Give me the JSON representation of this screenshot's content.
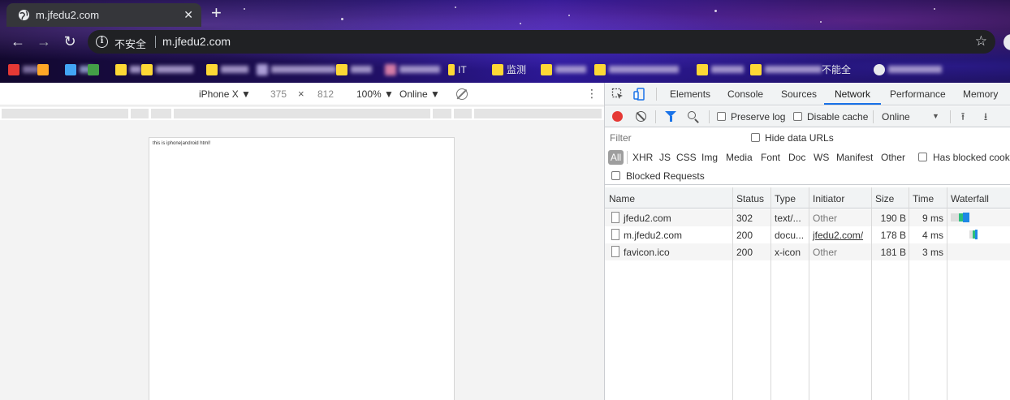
{
  "browser": {
    "tab_title": "m.jfedu2.com",
    "new_tab": "+",
    "tab_close": "✕",
    "security_label": "不安全",
    "url": "m.jfedu2.com",
    "bookmarks": [
      "IT",
      "监测",
      "不能全"
    ]
  },
  "device_toolbar": {
    "device": "iPhone X ▼",
    "width": "375",
    "times": "×",
    "height": "812",
    "zoom": "100% ▼",
    "network": "Online ▼",
    "more": "⋮"
  },
  "device_page": {
    "text": "this is iphone|android html!"
  },
  "devtools": {
    "tabs": [
      "Elements",
      "Console",
      "Sources",
      "Network",
      "Performance",
      "Memory"
    ],
    "active_tab": "Network",
    "preserve_log": "Preserve log",
    "disable_cache": "Disable cache",
    "throttling": "Online",
    "filter_placeholder": "Filter",
    "hide_data_urls": "Hide data URLs",
    "types": [
      "All",
      "XHR",
      "JS",
      "CSS",
      "Img",
      "Media",
      "Font",
      "Doc",
      "WS",
      "Manifest",
      "Other"
    ],
    "has_blocked_cookies": "Has blocked cooki",
    "blocked_requests": "Blocked Requests",
    "columns": [
      "Name",
      "Status",
      "Type",
      "Initiator",
      "Size",
      "Time",
      "Waterfall"
    ],
    "rows": [
      {
        "name": "jfedu2.com",
        "status": "302",
        "type": "text/...",
        "initiator": "Other",
        "size": "190 B",
        "time": "9 ms"
      },
      {
        "name": "m.jfedu2.com",
        "status": "200",
        "type": "docu...",
        "initiator": "jfedu2.com/",
        "size": "178 B",
        "time": "4 ms"
      },
      {
        "name": "favicon.ico",
        "status": "200",
        "type": "x-icon",
        "initiator": "Other",
        "size": "181 B",
        "time": "3 ms"
      }
    ]
  },
  "colors": {
    "accent": "#1a73e8",
    "record": "#e53935",
    "waterfall_green": "#2bbe79",
    "waterfall_blue": "#1e88e5"
  }
}
